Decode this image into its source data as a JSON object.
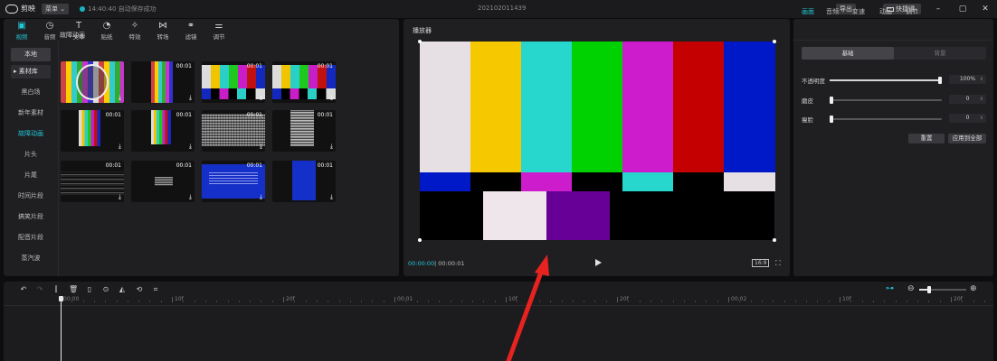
{
  "colors": {
    "accent": "#22c8d8",
    "bars_top": [
      "#e6dfe3",
      "#f5c800",
      "#27d6cc",
      "#00d100",
      "#cc1ccb",
      "#c40000",
      "#0019c8"
    ],
    "bars_mid": [
      "#0019c8",
      "#000000",
      "#cc1ccb",
      "#000000",
      "#27d6cc",
      "#000000",
      "#e6dfe3"
    ],
    "bars_bottom": [
      "#000000",
      "#efe6ec",
      "#670096",
      "#000000"
    ],
    "arrow": "#e8231f"
  },
  "titlebar": {
    "app_name": "剪映",
    "menu_label": "菜单",
    "save_status": "14:40:40 自动保存成功",
    "project_name": "202102011439",
    "export_label": "导出",
    "shortcut_label": "快捷键"
  },
  "media": {
    "tool_tabs": [
      {
        "label": "视频",
        "icon": "video-icon"
      },
      {
        "label": "音频",
        "icon": "audio-icon"
      },
      {
        "label": "文本",
        "icon": "text-icon"
      },
      {
        "label": "贴纸",
        "icon": "sticker-icon"
      },
      {
        "label": "特效",
        "icon": "effects-icon"
      },
      {
        "label": "转场",
        "icon": "transition-icon"
      },
      {
        "label": "滤镜",
        "icon": "filter-icon"
      },
      {
        "label": "调节",
        "icon": "adjust-icon"
      }
    ],
    "side_items": [
      "本地",
      "素材库",
      "黑白场",
      "新年素材",
      "故障动画",
      "片头",
      "片尾",
      "时间片段",
      "搞笑片段",
      "配音片段",
      "蒸汽波"
    ],
    "section_title": "故障动画",
    "thumbs": [
      {
        "duration": "",
        "style": "test-card"
      },
      {
        "duration": "00:01",
        "style": "test-card-small"
      },
      {
        "duration": "00:01",
        "style": "color-bars"
      },
      {
        "duration": "00:01",
        "style": "color-bars"
      },
      {
        "duration": "00:01",
        "style": "narrow-bars"
      },
      {
        "duration": "00:01",
        "style": "narrow-bars-small"
      },
      {
        "duration": "00:01",
        "style": "static-noise"
      },
      {
        "duration": "00:01",
        "style": "static-noise-small"
      },
      {
        "duration": "00:01",
        "style": "dark-lines"
      },
      {
        "duration": "00:01",
        "style": "dark-lines-small"
      },
      {
        "duration": "00:01",
        "style": "blue-screen"
      },
      {
        "duration": "00:01",
        "style": "blue-screen-small"
      }
    ]
  },
  "player": {
    "title": "播放器",
    "current_time": "00:00:00",
    "total_time": "00:00:01",
    "ratio_label": "16:9"
  },
  "properties": {
    "tabs": [
      "画面",
      "音频",
      "变速",
      "动画",
      "调节"
    ],
    "segment": {
      "active": "基础",
      "inactive": "背景"
    },
    "rows": [
      {
        "label": "不透明度",
        "value": "100%",
        "level": 1.0
      },
      {
        "label": "磨皮",
        "value": "0",
        "level": 0.0
      },
      {
        "label": "瘦脸",
        "value": "0",
        "level": 0.0
      }
    ],
    "reset_label": "重置",
    "apply_all_label": "应用到全部"
  },
  "timeline": {
    "ruler_labels": [
      "00:00",
      "10f",
      "20f",
      "00:01",
      "10f",
      "20f",
      "00:02",
      "10f",
      "20f"
    ]
  }
}
